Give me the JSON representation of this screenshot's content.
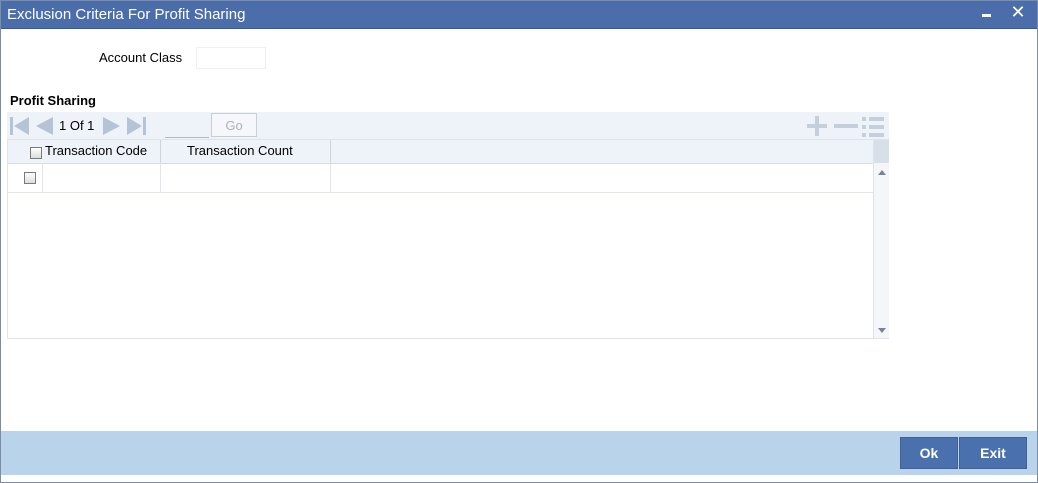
{
  "window": {
    "title": "Exclusion Criteria For Profit Sharing",
    "minimize_icon": "minimize-icon",
    "close_label": "✕"
  },
  "form": {
    "account_class_label": "Account Class",
    "account_class_value": ""
  },
  "section": {
    "title": "Profit Sharing"
  },
  "grid": {
    "pagination": {
      "current": "1",
      "of_label": "Of",
      "total": "1",
      "text": "1 Of 1"
    },
    "page_input_value": "",
    "go_label": "Go",
    "icons": [
      "first-page-icon",
      "previous-page-icon",
      "next-page-icon",
      "last-page-icon",
      "add-row-icon",
      "delete-row-icon",
      "view-rows-icon"
    ],
    "columns": [
      "Transaction Code",
      "Transaction Count"
    ],
    "rows": [
      {
        "transaction_code": "",
        "transaction_count": ""
      }
    ]
  },
  "footer": {
    "ok_label": "Ok",
    "exit_label": "Exit"
  },
  "colors": {
    "titlebar": "#4b6eaa",
    "footer": "#b9d4ea",
    "button": "#4a70ad",
    "grid_header": "#eef3f9"
  }
}
